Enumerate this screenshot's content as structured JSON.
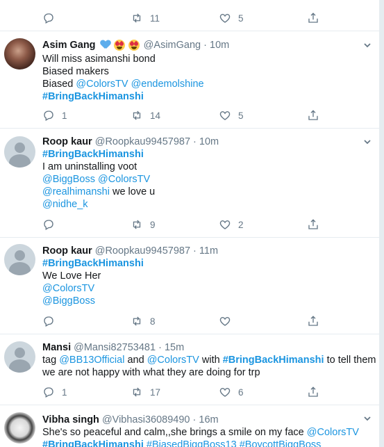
{
  "top_partial": {
    "retweets": "11",
    "likes": "5"
  },
  "tweets": [
    {
      "name": "Asim Gang",
      "handle": "@AsimGang",
      "dot": "·",
      "time": "10m",
      "lines": [
        [
          {
            "t": "Will miss asimanshi bond",
            "k": "text"
          }
        ],
        [
          {
            "t": "Biased makers",
            "k": "text"
          }
        ],
        [
          {
            "t": "Biased ",
            "k": "text"
          },
          {
            "t": "@ColorsTV",
            "k": "link"
          },
          {
            "t": " ",
            "k": "text"
          },
          {
            "t": "@endemolshine",
            "k": "link"
          }
        ],
        [
          {
            "t": "#BringBackHimanshi",
            "k": "tag"
          }
        ]
      ],
      "replies": "1",
      "retweets": "14",
      "likes": "5"
    },
    {
      "name": "Roop kaur",
      "handle": "@Roopkau99457987",
      "dot": "·",
      "time": "10m",
      "lines": [
        [
          {
            "t": "#BringBackHimanshi",
            "k": "tag"
          }
        ],
        [
          {
            "t": "I am uninstalling voot",
            "k": "text"
          }
        ],
        [
          {
            "t": "@BiggBoss",
            "k": "link"
          },
          {
            "t": " ",
            "k": "text"
          },
          {
            "t": "@ColorsTV",
            "k": "link"
          }
        ],
        [
          {
            "t": "@realhimanshi",
            "k": "link"
          },
          {
            "t": " we love u",
            "k": "text"
          }
        ],
        [
          {
            "t": "@nidhe_k",
            "k": "link"
          }
        ]
      ],
      "replies": "",
      "retweets": "9",
      "likes": "2"
    },
    {
      "name": "Roop kaur",
      "handle": "@Roopkau99457987",
      "dot": "·",
      "time": "11m",
      "lines": [
        [
          {
            "t": "#BringBackHimanshi",
            "k": "tag"
          }
        ],
        [
          {
            "t": "We Love Her",
            "k": "text"
          }
        ],
        [
          {
            "t": "@ColorsTV",
            "k": "link"
          }
        ],
        [
          {
            "t": "@BiggBoss",
            "k": "link"
          }
        ]
      ],
      "replies": "",
      "retweets": "8",
      "likes": ""
    },
    {
      "name": "Mansi",
      "handle": "@Mansi82753481",
      "dot": "·",
      "time": "15m",
      "lines": [
        [
          {
            "t": "tag ",
            "k": "text"
          },
          {
            "t": "@BB13Official",
            "k": "link"
          },
          {
            "t": " and ",
            "k": "text"
          },
          {
            "t": "@ColorsTV",
            "k": "link"
          },
          {
            "t": " with ",
            "k": "text"
          },
          {
            "t": "#BringBackHimanshi",
            "k": "tag"
          },
          {
            "t": " to tell them",
            "k": "text"
          }
        ],
        [
          {
            "t": "we are not happy with what they are doing for trp",
            "k": "text"
          }
        ]
      ],
      "replies": "1",
      "retweets": "17",
      "likes": "6"
    },
    {
      "name": "Vibha singh",
      "handle": "@Vibhasi36089490",
      "dot": "·",
      "time": "16m",
      "lines": [
        [
          {
            "t": "She's so peaceful and calm,,she brings a smile on my face ",
            "k": "text"
          },
          {
            "t": "@ColorsTV",
            "k": "link"
          }
        ],
        [
          {
            "t": "#BringBackHimanshi",
            "k": "tag"
          },
          {
            "t": " ",
            "k": "text"
          },
          {
            "t": "#BiasedBiggBoss13",
            "k": "link"
          },
          {
            "t": " ",
            "k": "text"
          },
          {
            "t": "#BoycottBiggBoss",
            "k": "link"
          }
        ]
      ],
      "replies": "",
      "retweets": "",
      "likes": ""
    }
  ],
  "icons": {
    "reply": "reply-icon",
    "retweet": "retweet-icon",
    "like": "heart-icon",
    "share": "share-icon",
    "more": "chevron-down-icon"
  },
  "colors": {
    "link": "#1b95e0",
    "accent": "#1da1f2",
    "muted": "#657786"
  }
}
